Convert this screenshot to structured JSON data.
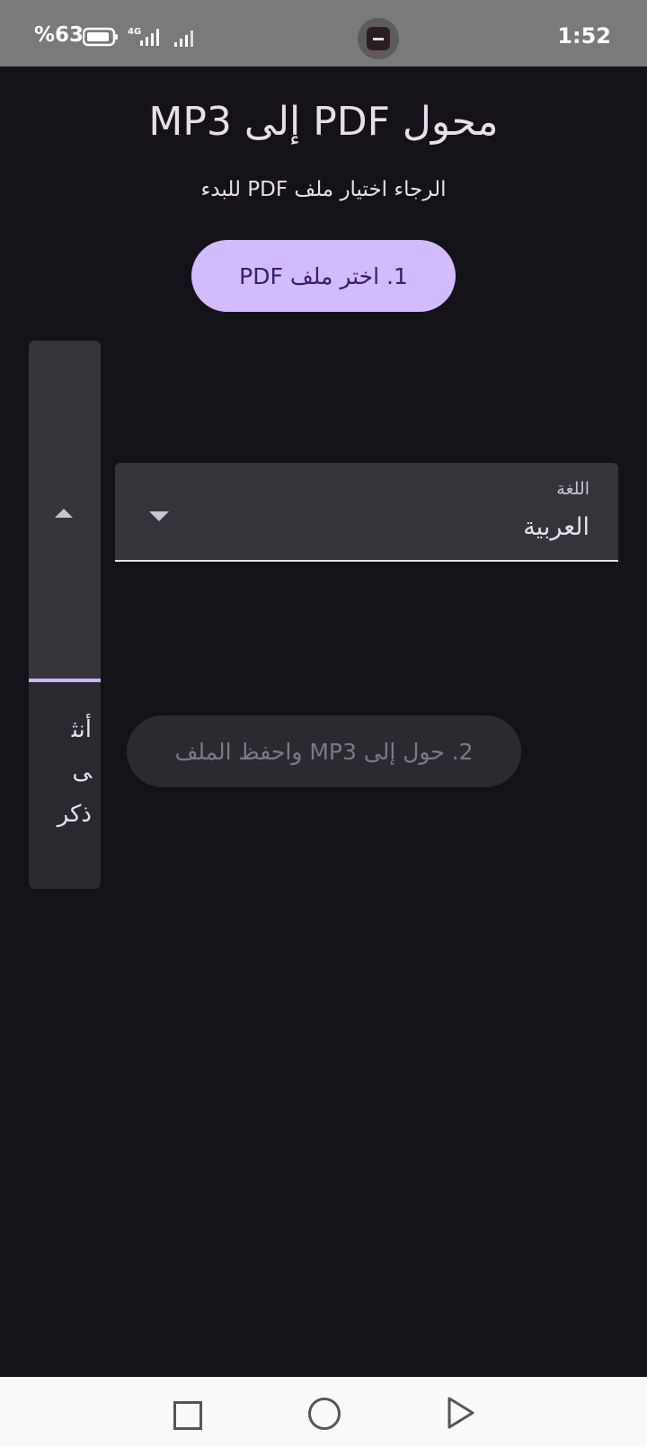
{
  "status_bar": {
    "battery": "%63",
    "network": "4G",
    "time": "1:52"
  },
  "app": {
    "title": "محول PDF إلى MP3",
    "subtitle": "الرجاء اختيار ملف PDF للبدء",
    "pick_button": "1. اختر ملف PDF",
    "language_field": {
      "label": "اللغة",
      "value": "العربية"
    },
    "gender_options": [
      "أنثى",
      "ذكر"
    ],
    "convert_button": "2. حول إلى MP3 واحفظ الملف"
  },
  "colors": {
    "background": "#141218",
    "primary_button": "#d0bcff",
    "primary_text": "#381e72",
    "accent": "#cbb6f8"
  },
  "icons": {
    "battery": "battery-icon",
    "signal": "signal-icon",
    "dropdown": "chevron-down-icon",
    "spinner_up": "chevron-up-icon",
    "nav_recent": "square-icon",
    "nav_home": "circle-icon",
    "nav_back": "triangle-icon"
  }
}
